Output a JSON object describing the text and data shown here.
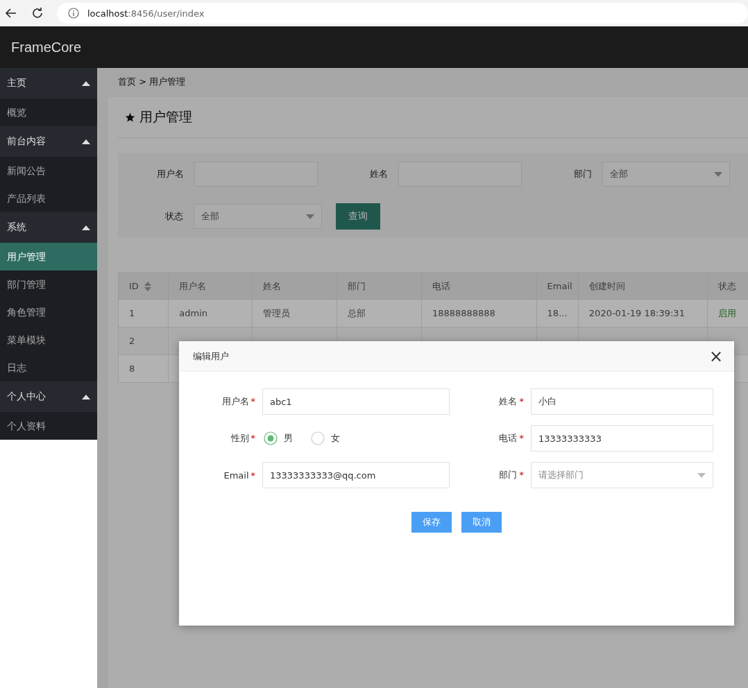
{
  "browser": {
    "url_host": "localhost",
    "url_path": ":8456/user/index"
  },
  "header": {
    "brand": "FrameCore"
  },
  "sidebar": {
    "groups": [
      {
        "title": "主页",
        "expanded": true,
        "items": [
          {
            "label": "概览",
            "selected": false
          }
        ]
      },
      {
        "title": "前台内容",
        "expanded": true,
        "items": [
          {
            "label": "新闻公告",
            "selected": false
          },
          {
            "label": "产品列表",
            "selected": false
          }
        ]
      },
      {
        "title": "系统",
        "expanded": true,
        "items": [
          {
            "label": "用户管理",
            "selected": true
          },
          {
            "label": "部门管理",
            "selected": false
          },
          {
            "label": "角色管理",
            "selected": false
          },
          {
            "label": "菜单模块",
            "selected": false
          },
          {
            "label": "日志",
            "selected": false
          }
        ]
      },
      {
        "title": "个人中心",
        "expanded": true,
        "items": [
          {
            "label": "个人资料",
            "selected": false
          }
        ]
      }
    ]
  },
  "breadcrumb": "首页 > 用户管理",
  "page_title": "用户管理",
  "filters": [
    {
      "label": "用户名",
      "kind": "input"
    },
    {
      "label": "姓名",
      "kind": "input"
    },
    {
      "label": "部门",
      "kind": "select",
      "value": "全部"
    },
    {
      "label": "状态",
      "kind": "select",
      "value": "全部"
    }
  ],
  "query_button": "查询",
  "table": {
    "columns": [
      "ID",
      "用户名",
      "姓名",
      "部门",
      "电话",
      "Email",
      "创建时间",
      "状态"
    ],
    "rows": [
      {
        "cells": [
          "1",
          "admin",
          "管理员",
          "总部",
          "18888888888",
          "18...",
          "2020-01-19 18:39:31",
          "启用"
        ]
      },
      {
        "cells": [
          "2"
        ]
      },
      {
        "cells": [
          "8"
        ]
      }
    ]
  },
  "dialog": {
    "title": "编辑用户",
    "close": "×",
    "fields": [
      {
        "label": "用户名",
        "required": "*",
        "kind": "input",
        "value": "abc1"
      },
      {
        "label": "姓名",
        "required": "*",
        "kind": "input",
        "value": "小白"
      },
      {
        "label": "性别",
        "required": "*",
        "kind": "radio",
        "options": [
          {
            "label": "男",
            "selected": true
          },
          {
            "label": "女",
            "selected": false
          }
        ]
      },
      {
        "label": "电话",
        "required": "*",
        "kind": "input",
        "value": "13333333333"
      },
      {
        "label": "Email",
        "required": "*",
        "kind": "input",
        "value": "13333333333@qq.com"
      },
      {
        "label": "部门",
        "required": "*",
        "kind": "select",
        "placeholder": "请选择部门"
      }
    ],
    "buttons": [
      "保存",
      "取消"
    ]
  }
}
